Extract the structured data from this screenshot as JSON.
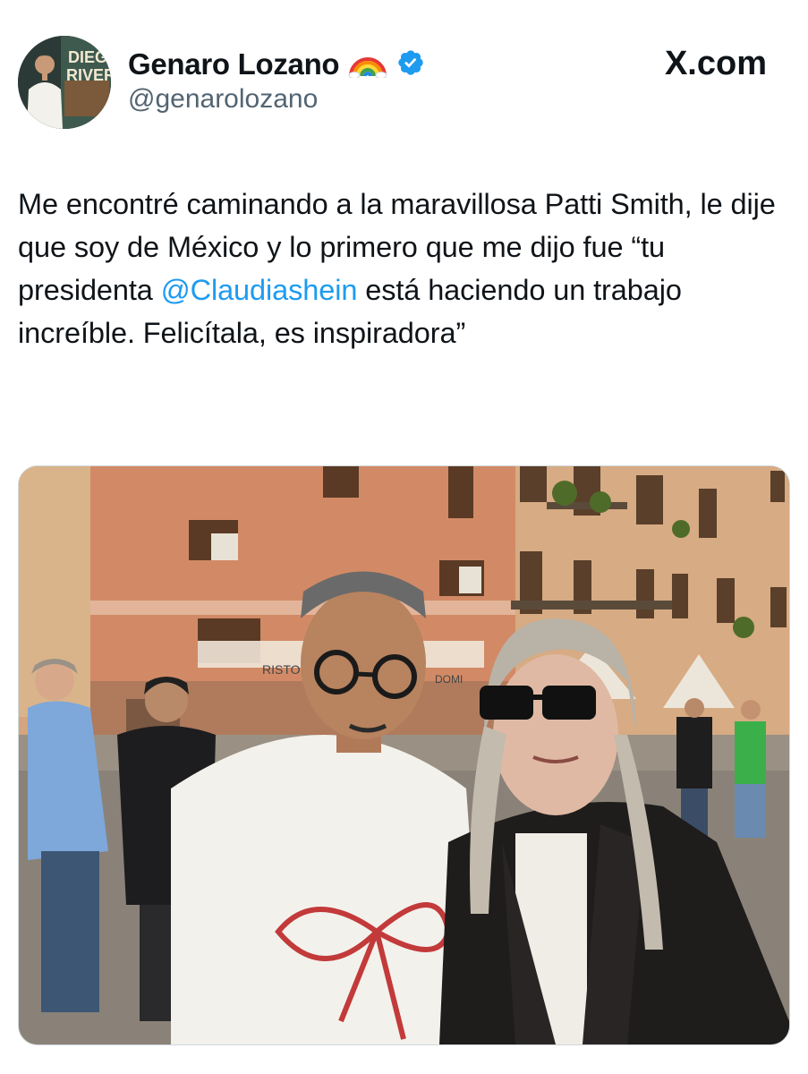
{
  "author": {
    "display_name": "Genaro Lozano",
    "handle": "@genarolozano",
    "name_emoji": "rainbow-icon",
    "verified_badge": "verified-badge-icon",
    "avatar_poster_text": [
      "DIEGO",
      "RIVERA"
    ]
  },
  "header": {
    "site_label": "X.com"
  },
  "tweet": {
    "text_part1": "Me encontré caminando a la maravillosa Patti Smith, le dije que soy de México y lo primero que me dijo fue “tu presidenta ",
    "mention": "@Claudiashein",
    "text_part2": " está haciendo un trabajo increíble. Felicítala, es inspiradora”"
  },
  "media": {
    "type": "photo",
    "storefront_signs": [
      "RISTO",
      "DOMI"
    ]
  },
  "colors": {
    "text_primary": "#0f1419",
    "text_secondary": "#536471",
    "accent_blue": "#1d9bf0",
    "border": "#cfd9de"
  }
}
